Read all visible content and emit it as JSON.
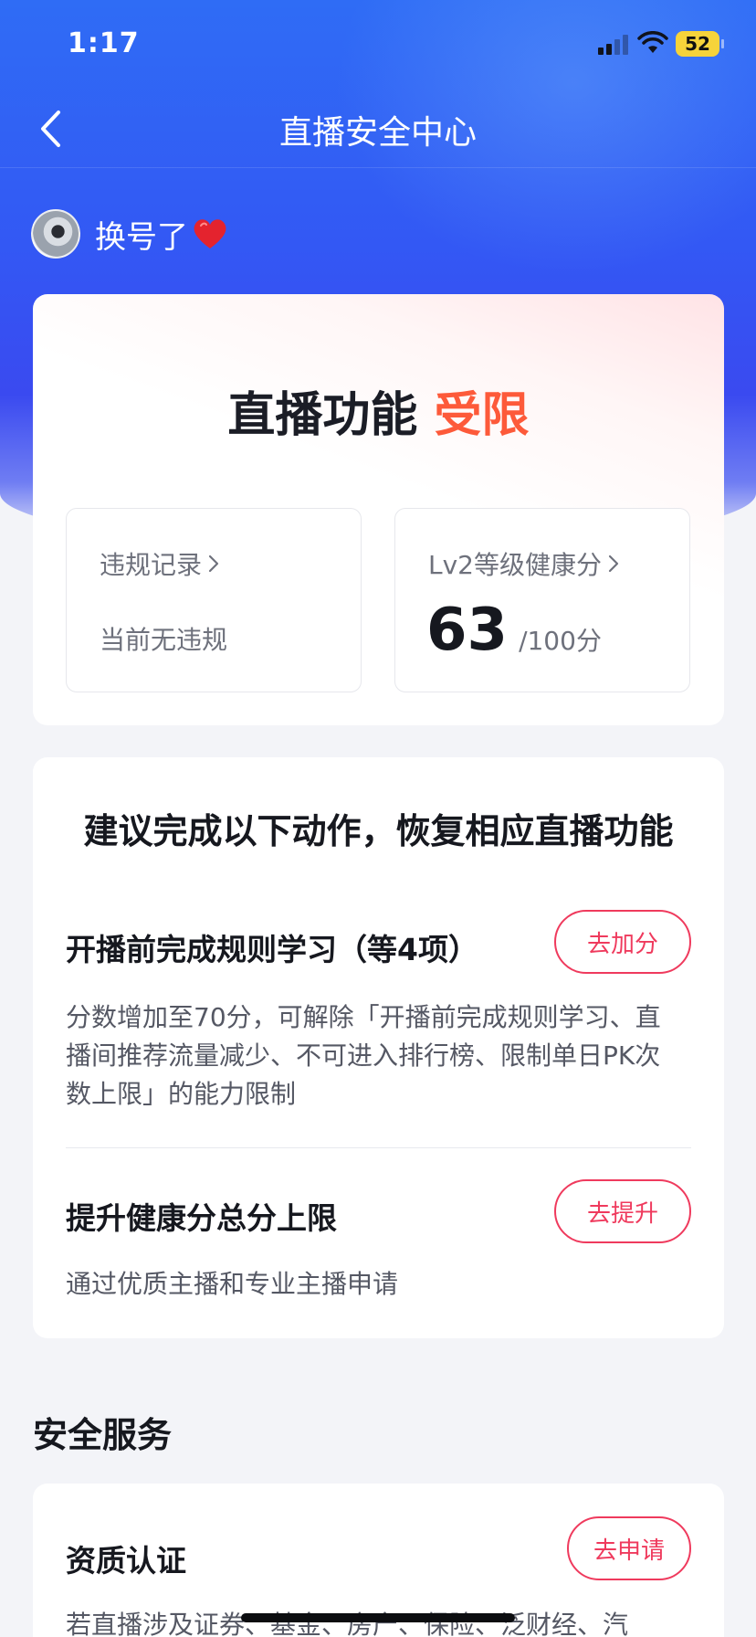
{
  "status_bar": {
    "time": "1:17",
    "battery": "52"
  },
  "nav": {
    "title": "直播安全中心"
  },
  "user": {
    "name": "换号了"
  },
  "status_card": {
    "heading_prefix": "直播功能",
    "heading_accent": "受限",
    "violation": {
      "label": "违规记录",
      "value": "当前无违规"
    },
    "health": {
      "label": "Lv2等级健康分",
      "score": "63",
      "total": "/100分"
    }
  },
  "suggestions": {
    "title": "建议完成以下动作，恢复相应直播功能",
    "items": [
      {
        "title": "开播前完成规则学习（等4项）",
        "button": "去加分",
        "desc": "分数增加至70分，可解除「开播前完成规则学习、直播间推荐流量减少、不可进入排行榜、限制单日PK次数上限」的能力限制"
      },
      {
        "title": "提升健康分总分上限",
        "button": "去提升",
        "desc": "通过优质主播和专业主播申请"
      }
    ]
  },
  "safety_services": {
    "section_title": "安全服务",
    "items": [
      {
        "title": "资质认证",
        "button": "去申请",
        "desc": "若直播涉及证券、基金、房产、保险、泛财经、汽"
      }
    ]
  },
  "colors": {
    "accent_red": "#ef3a5d",
    "limited_orange": "#fd5a3a",
    "brand_blue": "#3358f4"
  },
  "icons": [
    "back-chevron-icon",
    "signal-icon",
    "wifi-icon",
    "battery-icon",
    "heart-emoji-icon",
    "chevron-right-icon"
  ]
}
